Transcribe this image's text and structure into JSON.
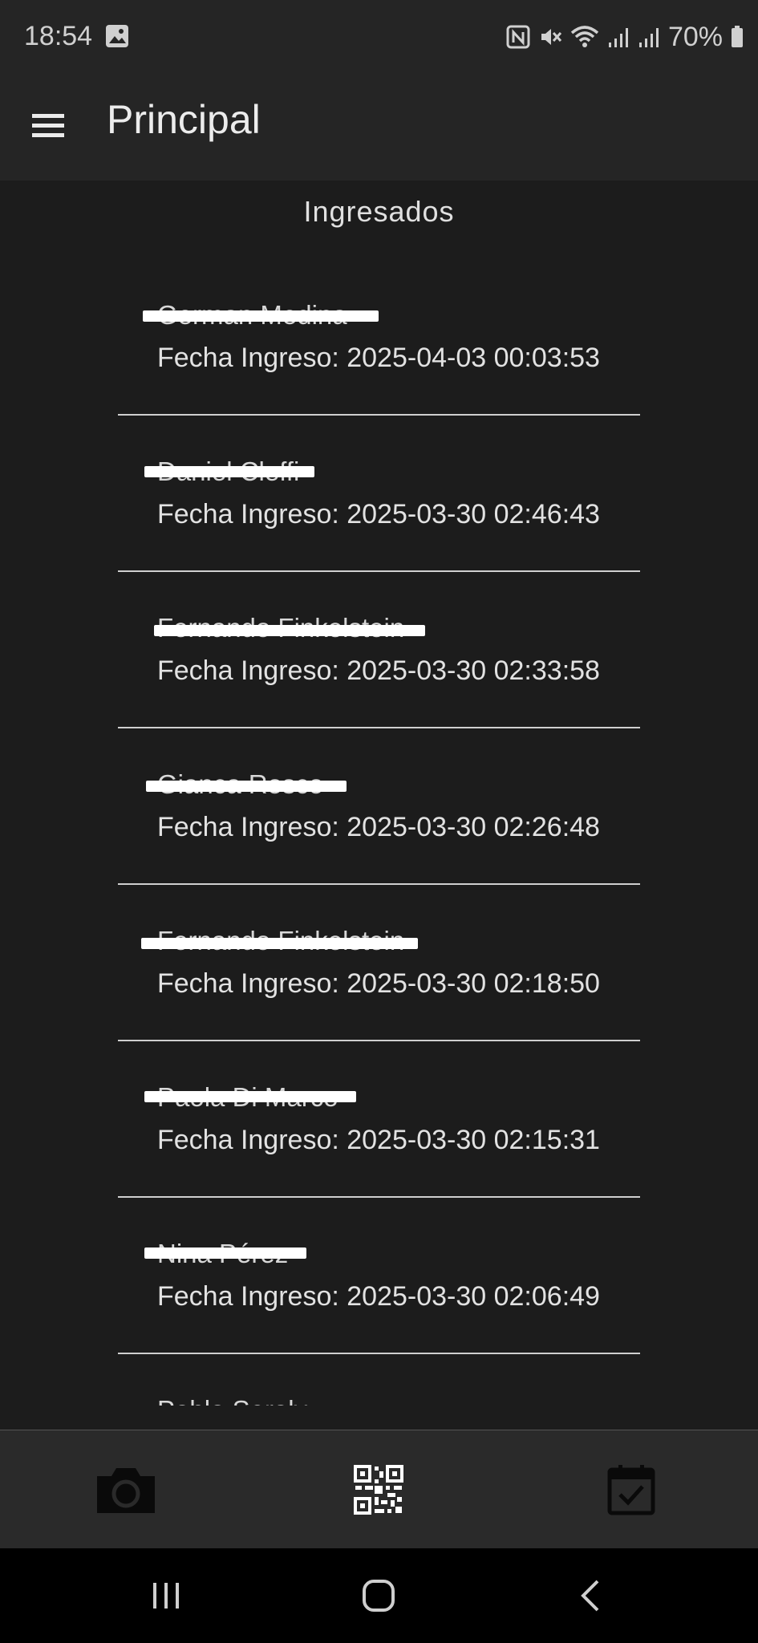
{
  "status_bar": {
    "time": "18:54",
    "battery": "70%",
    "icons": [
      "gallery-icon",
      "nfc-icon",
      "mute-icon",
      "wifi-icon",
      "signal-icon",
      "signal-icon",
      "battery-icon"
    ]
  },
  "app_bar": {
    "title": "Principal",
    "menu_icon": "menu-icon"
  },
  "section": {
    "title": "Ingresados"
  },
  "entries": [
    {
      "name": "German Medina",
      "date": "Fecha Ingreso: 2025-04-03 00:03:53"
    },
    {
      "name": "Daniel Cleffi",
      "date": "Fecha Ingreso: 2025-03-30 02:46:43"
    },
    {
      "name": "Fernando Finkelstein",
      "date": "Fecha Ingreso: 2025-03-30 02:33:58"
    },
    {
      "name": "Gianca Rosco",
      "date": "Fecha Ingreso: 2025-03-30 02:26:48"
    },
    {
      "name": "Fernando Finkelstein",
      "date": "Fecha Ingreso: 2025-03-30 02:18:50"
    },
    {
      "name": "Paola Di Marco",
      "date": "Fecha Ingreso: 2025-03-30 02:15:31"
    },
    {
      "name": "Nina Pérez",
      "date": "Fecha Ingreso: 2025-03-30 02:06:49"
    },
    {
      "name": "Pablo Seraly",
      "date": ""
    }
  ],
  "bottom_nav": {
    "items": [
      "camera-icon",
      "qr-code-icon",
      "calendar-check-icon"
    ]
  },
  "system_nav": {
    "items": [
      "recents-icon",
      "home-icon",
      "back-icon"
    ]
  },
  "colors": {
    "background": "#1c1c1c",
    "app_bar": "#252525",
    "bottom_nav": "#2a2a2a",
    "divider": "#cfcfcf",
    "redaction": "#ffffff"
  }
}
